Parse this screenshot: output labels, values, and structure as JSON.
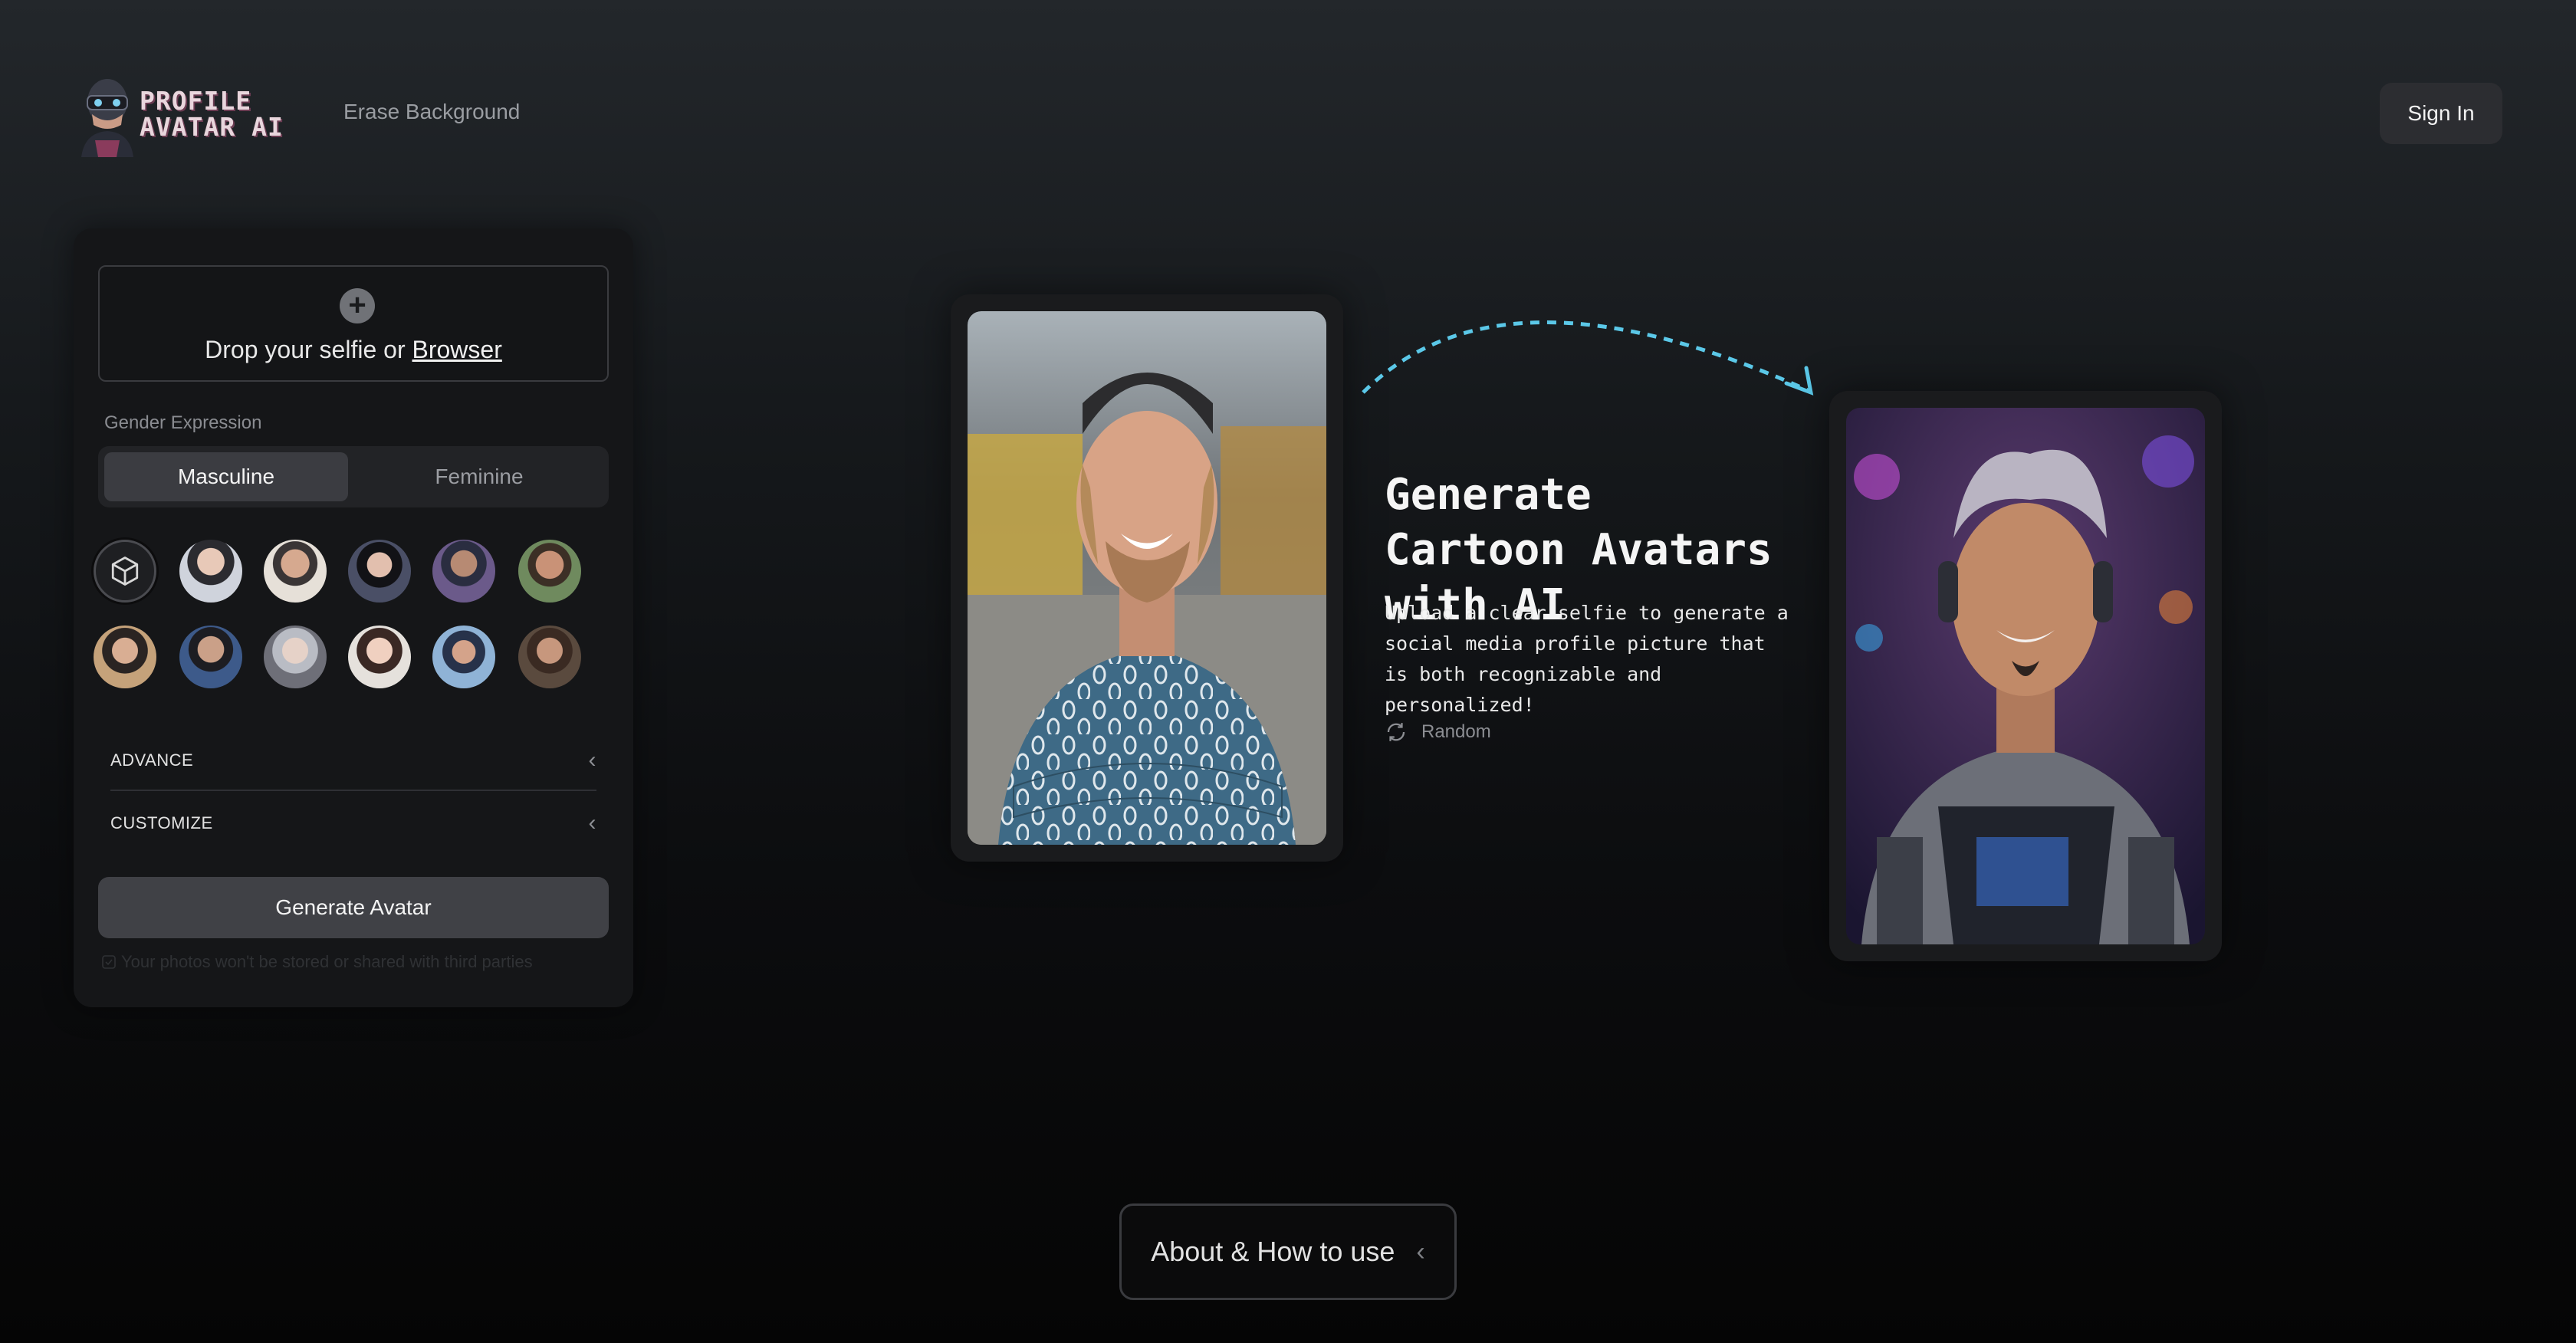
{
  "header": {
    "logo_line1": "PROFILE",
    "logo_line2": "AVATAR AI",
    "nav_erase": "Erase Background",
    "sign_in": "Sign In"
  },
  "panel": {
    "drop_prefix": "Drop your selfie or ",
    "drop_link": "Browser",
    "gender_label": "Gender Expression",
    "gender_options": [
      "Masculine",
      "Feminine"
    ],
    "gender_selected": "Masculine",
    "advance_label": "ADVANCE",
    "customize_label": "CUSTOMIZE",
    "generate_label": "Generate Avatar",
    "privacy_text": "Your photos won't be stored or shared with third parties"
  },
  "hero": {
    "title": "Generate Cartoon Avatars with AI",
    "description": "Upload a clear selfie to generate a social media profile picture that is both recognizable and personalized!",
    "random_label": "Random"
  },
  "footer": {
    "about_label": "About & How to use"
  },
  "colors": {
    "accent_arrow": "#5bc8e8",
    "panel_bg": "#151618",
    "button_bg": "#404146"
  },
  "icons": [
    "plus-icon",
    "cube-icon",
    "chevron-left-icon",
    "refresh-icon",
    "check-icon"
  ]
}
